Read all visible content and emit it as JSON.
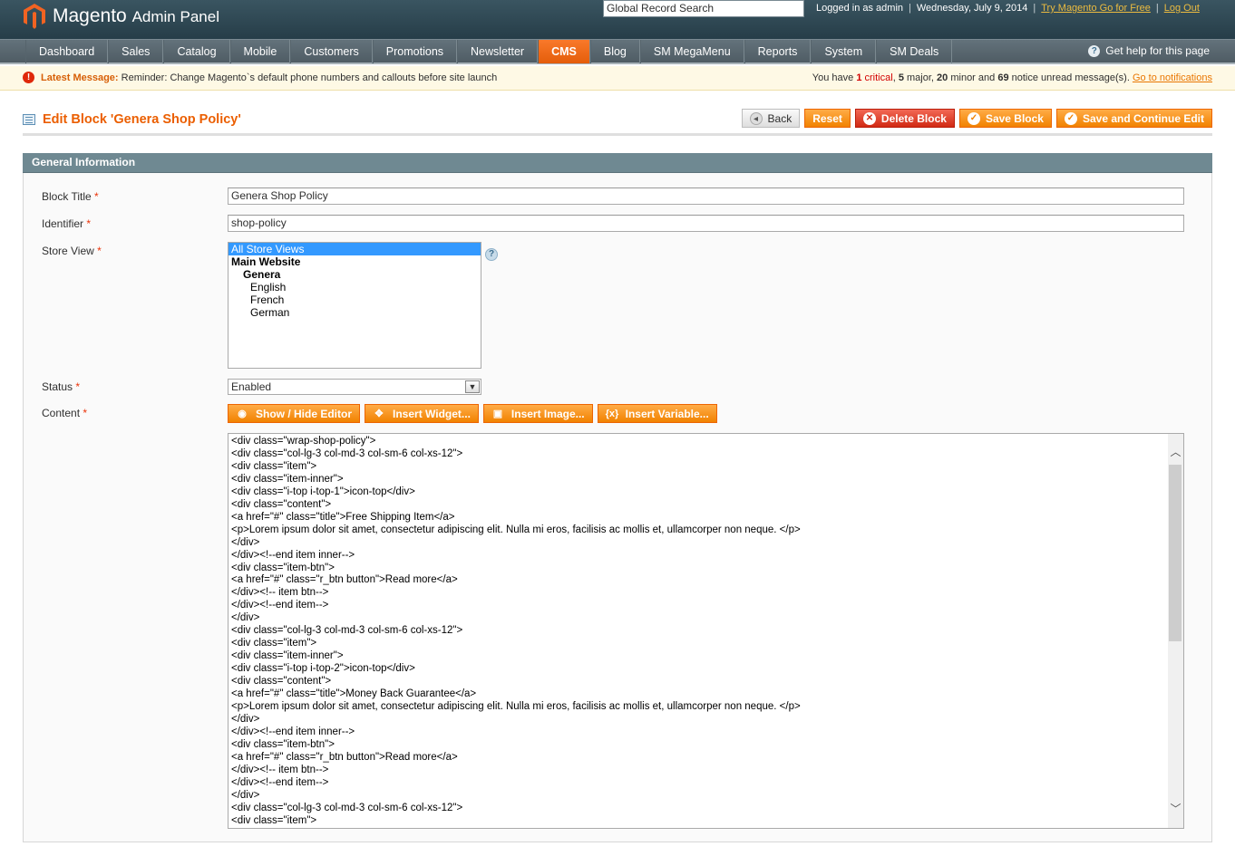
{
  "header": {
    "logo_text": "Magento",
    "logo_sub": "Admin Panel",
    "search_value": "Global Record Search",
    "logged_in": "Logged in as admin",
    "date": "Wednesday, July 9, 2014",
    "try_link": "Try Magento Go for Free",
    "logout": "Log Out"
  },
  "nav": {
    "items": [
      "Dashboard",
      "Sales",
      "Catalog",
      "Mobile",
      "Customers",
      "Promotions",
      "Newsletter",
      "CMS",
      "Blog",
      "SM MegaMenu",
      "Reports",
      "System",
      "SM Deals"
    ],
    "active": "CMS",
    "help": "Get help for this page"
  },
  "message": {
    "label": "Latest Message:",
    "text": "Reminder: Change Magento`s default phone numbers and callouts before site launch",
    "right_prefix": "You have",
    "critical_count": "1",
    "critical_label": "critical",
    "major": "5",
    "major_label": "major,",
    "minor": "20",
    "minor_label": "minor and",
    "notice": "69",
    "notice_label": "notice unread message(s).",
    "link": "Go to notifications"
  },
  "page": {
    "title": "Edit Block 'Genera Shop Policy'",
    "buttons": {
      "back": "Back",
      "reset": "Reset",
      "delete": "Delete Block",
      "save": "Save Block",
      "save_continue": "Save and Continue Edit"
    }
  },
  "form": {
    "section": "General Information",
    "block_title_label": "Block Title",
    "block_title_value": "Genera Shop Policy",
    "identifier_label": "Identifier",
    "identifier_value": "shop-policy",
    "store_view_label": "Store View",
    "store_options": [
      "All Store Views",
      "Main Website",
      "Genera",
      "English",
      "French",
      "German"
    ],
    "status_label": "Status",
    "status_value": "Enabled",
    "content_label": "Content",
    "required_mark": "*",
    "editor_buttons": [
      "Show / Hide Editor",
      "Insert Widget...",
      "Insert Image...",
      "Insert Variable..."
    ],
    "content_lines": [
      "<div class=\"wrap-shop-policy\">",
      "<div class=\"col-lg-3 col-md-3 col-sm-6 col-xs-12\">",
      "<div class=\"item\">",
      "<div class=\"item-inner\">",
      "<div class=\"i-top i-top-1\">icon-top</div>",
      "<div class=\"content\">",
      "<a href=\"#\" class=\"title\">Free Shipping Item</a>",
      "<p>Lorem ipsum dolor sit amet, consectetur adipiscing elit. Nulla mi eros, facilisis ac mollis et, ullamcorper non neque. </p>",
      "</div>",
      "</div><!--end item inner-->",
      "<div class=\"item-btn\">",
      "<a href=\"#\" class=\"r_btn button\">Read more</a>",
      "</div><!-- item btn-->",
      "</div><!--end item-->",
      "</div>",
      "<div class=\"col-lg-3 col-md-3 col-sm-6 col-xs-12\">",
      "<div class=\"item\">",
      "<div class=\"item-inner\">",
      "<div class=\"i-top i-top-2\">icon-top</div>",
      "<div class=\"content\">",
      "<a href=\"#\" class=\"title\">Money Back Guarantee</a>",
      "<p>Lorem ipsum dolor sit amet, consectetur adipiscing elit. Nulla mi eros, facilisis ac mollis et, ullamcorper non neque. </p>",
      "</div>",
      "</div><!--end item inner-->",
      "<div class=\"item-btn\">",
      "<a href=\"#\" class=\"r_btn button\">Read more</a>",
      "</div><!-- item btn-->",
      "</div><!--end item-->",
      "</div>",
      "<div class=\"col-lg-3 col-md-3 col-sm-6 col-xs-12\">",
      "<div class=\"item\">"
    ]
  },
  "icons": {
    "logo": "magento-logo-icon",
    "help": "help-icon",
    "message": "error-icon",
    "title": "grid-icon"
  },
  "colors": {
    "accent": "#eb5e00",
    "header_bg": "#2b4350",
    "button_orange": "#f18200",
    "delete_red": "#d12a14",
    "section_head": "#6f8992"
  }
}
